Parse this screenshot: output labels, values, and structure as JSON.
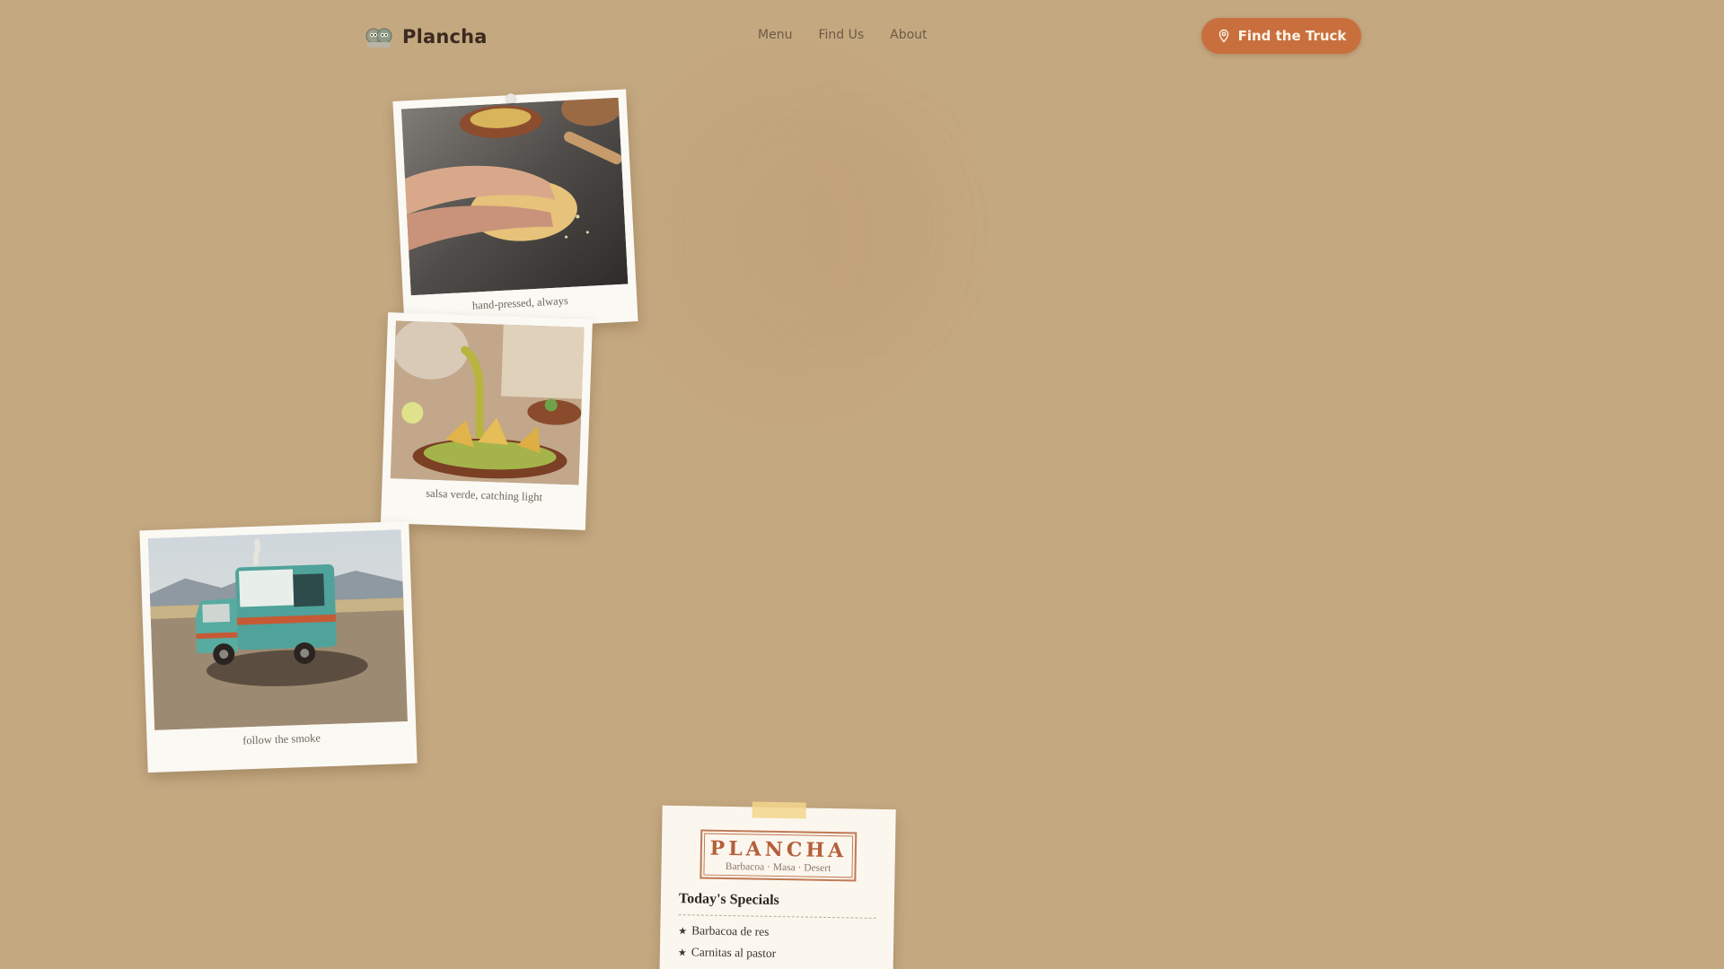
{
  "brand": {
    "name": "Plancha",
    "logo_icon": "ghost-faces-icon"
  },
  "nav": {
    "links": [
      {
        "label": "Menu"
      },
      {
        "label": "Find Us"
      },
      {
        "label": "About"
      }
    ],
    "cta": {
      "label": "Find the Truck",
      "icon": "map-pin-icon"
    }
  },
  "polaroids": [
    {
      "caption": "hand-pressed, always",
      "image": "hands-pressing-masa-dough-photo"
    },
    {
      "caption": "salsa verde, catching light",
      "image": "salsa-verde-pour-photo"
    },
    {
      "caption": "follow the smoke",
      "image": "food-truck-in-desert-photo"
    }
  ],
  "card": {
    "stamp_title": "PLANCHA",
    "stamp_subtitle": "Barbacoa · Masa · Desert",
    "specials_title": "Today's Specials",
    "specials": [
      {
        "name": "Barbacoa de res"
      },
      {
        "name": "Carnitas al pastor"
      }
    ],
    "bullet": "★"
  },
  "colors": {
    "background": "#c4a880",
    "accent": "#c96f3e",
    "text_dark": "#3a2a1f",
    "nav_text": "#6d5a47",
    "stamp": "#b55f3b"
  }
}
